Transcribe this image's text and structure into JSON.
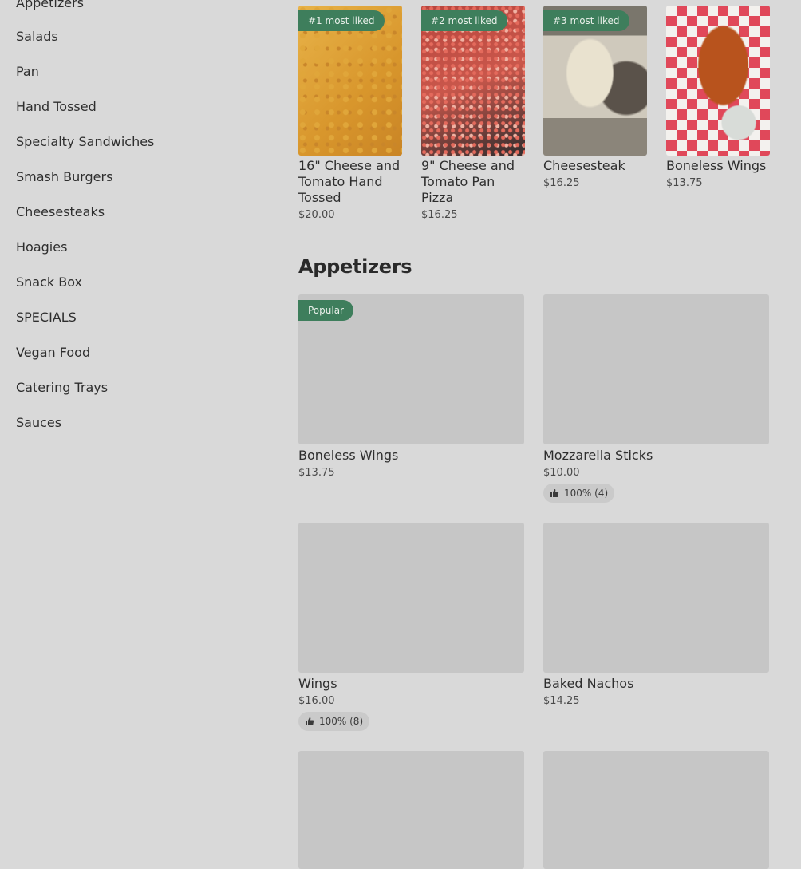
{
  "sidebar": {
    "items": [
      {
        "label": "Appetizers"
      },
      {
        "label": "Salads"
      },
      {
        "label": "Pan"
      },
      {
        "label": "Hand Tossed"
      },
      {
        "label": "Specialty Sandwiches"
      },
      {
        "label": "Smash Burgers"
      },
      {
        "label": "Cheesesteaks"
      },
      {
        "label": "Hoagies"
      },
      {
        "label": "Snack Box"
      },
      {
        "label": "SPECIALS"
      },
      {
        "label": "Vegan Food"
      },
      {
        "label": "Catering Trays"
      },
      {
        "label": "Sauces"
      }
    ]
  },
  "most_liked": [
    {
      "badge": "#1 most liked",
      "name": "16\" Cheese and Tomato Hand Tossed",
      "price": "$20.00"
    },
    {
      "badge": "#2 most liked",
      "name": "9\" Cheese and Tomato Pan Pizza",
      "price": "$16.25"
    },
    {
      "badge": "#3 most liked",
      "name": "Cheesesteak",
      "price": "$16.25"
    },
    {
      "badge": "",
      "name": "Boneless Wings",
      "price": "$13.75"
    }
  ],
  "section": {
    "title": "Appetizers"
  },
  "items": [
    {
      "badge": "Popular",
      "name": "Boneless Wings",
      "price": "$13.75",
      "rating": ""
    },
    {
      "badge": "",
      "name": "Mozzarella Sticks",
      "price": "$10.00",
      "rating": "100% (4)"
    },
    {
      "badge": "",
      "name": "Wings",
      "price": "$16.00",
      "rating": "100% (8)"
    },
    {
      "badge": "",
      "name": "Baked Nachos",
      "price": "$14.25",
      "rating": ""
    }
  ],
  "colors": {
    "badge_bg": "#3e7e5c",
    "page_bg": "#d9d9d9",
    "placeholder": "#c6c6c6"
  }
}
